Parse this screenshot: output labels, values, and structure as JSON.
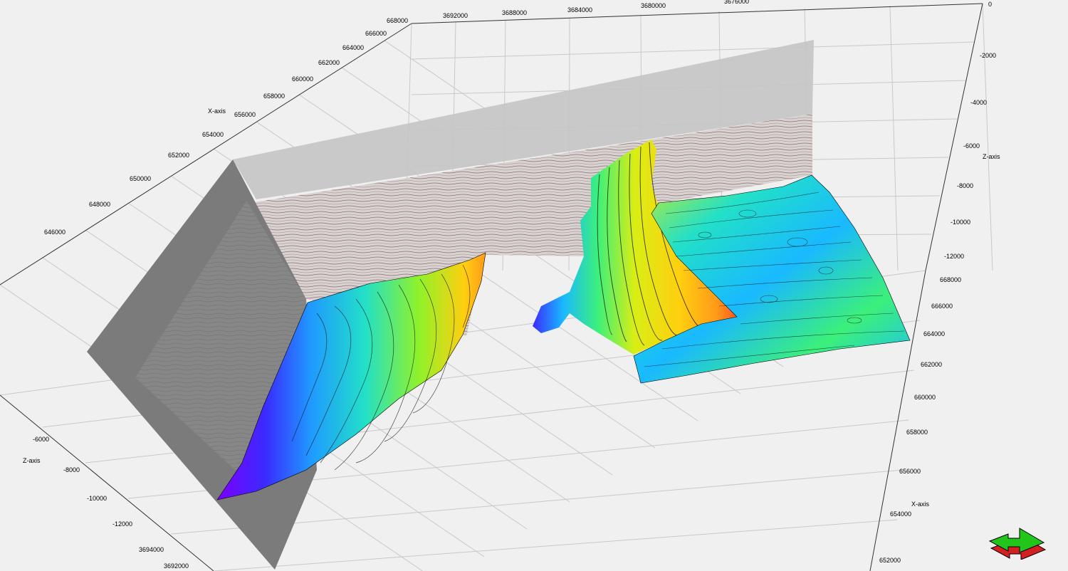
{
  "axes": {
    "x_back": {
      "title": "X-axis",
      "ticks": [
        "646000",
        "648000",
        "650000",
        "652000",
        "654000",
        "656000",
        "658000",
        "660000",
        "662000",
        "664000",
        "666000",
        "668000"
      ]
    },
    "y_top": {
      "ticks": [
        "3692000",
        "3688000",
        "3684000",
        "3680000",
        "3676000"
      ]
    },
    "z_right": {
      "title": "Z-axis",
      "ticks": [
        "0",
        "-2000",
        "-4000",
        "-6000",
        "-8000",
        "-10000",
        "-12000"
      ]
    },
    "x_right": {
      "title": "X-axis",
      "ticks": [
        "668000",
        "666000",
        "664000",
        "662000",
        "660000",
        "658000",
        "656000",
        "654000",
        "652000"
      ]
    },
    "z_left": {
      "title": "Z-axis",
      "ticks": [
        "-6000",
        "-8000",
        "-10000",
        "-12000"
      ]
    },
    "y_bottom": {
      "ticks": [
        "3694000",
        "3692000"
      ]
    }
  },
  "colors": {
    "background": "#f0f0f0",
    "grid": "#c8c8c8",
    "seismic_panel": "#c6c6c6",
    "seismic_dark_panel": "#7a7a7a",
    "surface_colormap": [
      "#7b00ff",
      "#3a2bff",
      "#1f7cff",
      "#19b9ff",
      "#22e0c8",
      "#3cf07a",
      "#8ff22a",
      "#d9ee14",
      "#ffcf10",
      "#ff9a1a",
      "#ff5a1e"
    ],
    "widget_green": "#22c51a",
    "widget_red": "#d42020"
  },
  "orientation_widget": {
    "icon": "3d-orientation-arrow-icon"
  }
}
